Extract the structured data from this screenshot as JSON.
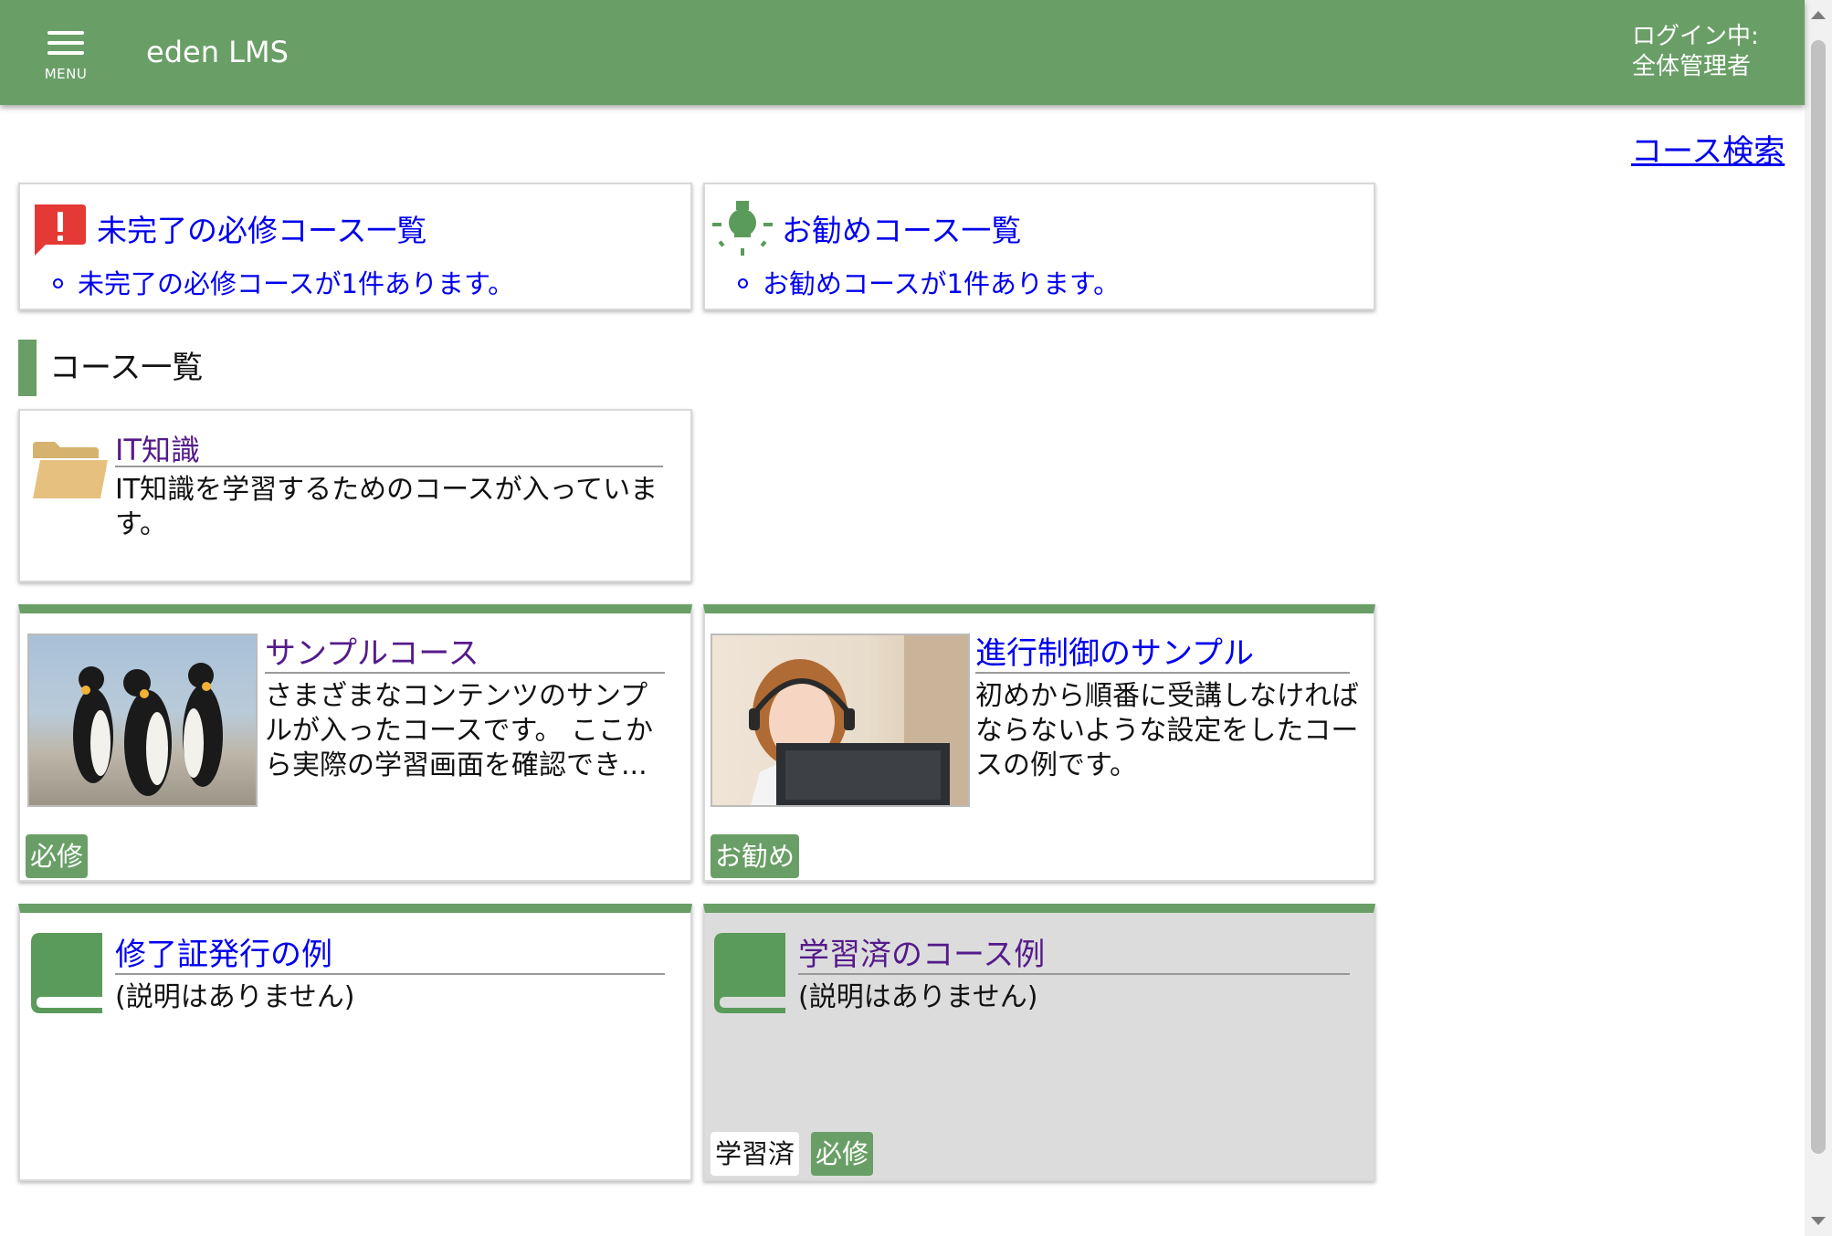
{
  "header": {
    "menu_label": "MENU",
    "app_title": "eden LMS",
    "login_status": "ログイン中:",
    "login_user": "全体管理者"
  },
  "search_link": "コース検索",
  "notices": [
    {
      "title": "未完了の必修コース一覧",
      "item": "未完了の必修コースが1件あります。",
      "icon": "alert-icon",
      "icon_color": "#e53935"
    },
    {
      "title": "お勧めコース一覧",
      "item": "お勧めコースが1件あります。",
      "icon": "lightbulb-icon",
      "icon_color": "#5a9a5a"
    }
  ],
  "section_title": "コース一覧",
  "folder": {
    "title": "IT知識",
    "description": "IT知識を学習するためのコースが入っています。",
    "icon": "folder-icon"
  },
  "courses": [
    {
      "title": "サンプルコース",
      "description": "さまざまなコンテンツのサンプルが入ったコースです。 ここから実際の学習画面を確認でき...",
      "badges": [
        "必修"
      ],
      "thumbnail": "penguins-image"
    },
    {
      "title": "進行制御のサンプル",
      "description": "初めから順番に受講しなければならないような設定をしたコースの例です。",
      "badges": [
        "お勧め"
      ],
      "thumbnail": "headset-woman-image"
    },
    {
      "title": "修了証発行の例",
      "description": "(説明はありません)",
      "badges": [],
      "icon": "book-icon"
    },
    {
      "title": "学習済のコース例",
      "description": "(説明はありません)",
      "badges": [
        "学習済",
        "必修"
      ],
      "icon": "book-icon"
    }
  ],
  "colors": {
    "brand": "#699f66",
    "link": "#0000ee",
    "visited_link": "#551a8b",
    "completed_card_bg": "#dcdcdc"
  }
}
